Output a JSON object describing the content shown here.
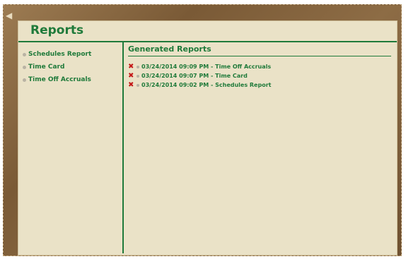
{
  "panel": {
    "title": "Reports"
  },
  "sidebar": {
    "items": [
      {
        "label": "Schedules Report"
      },
      {
        "label": "Time Card"
      },
      {
        "label": "Time Off Accruals"
      }
    ]
  },
  "main": {
    "title": "Generated Reports",
    "reports": [
      {
        "label": "03/24/2014 09:09 PM - Time Off Accruals"
      },
      {
        "label": "03/24/2014 09:07 PM - Time Card"
      },
      {
        "label": "03/24/2014 09:02 PM - Schedules Report"
      }
    ]
  },
  "colors": {
    "accent": "#1f7a3a",
    "delete": "#c41818",
    "panel_bg": "#eae2c7",
    "frame": "#8d6c45"
  }
}
